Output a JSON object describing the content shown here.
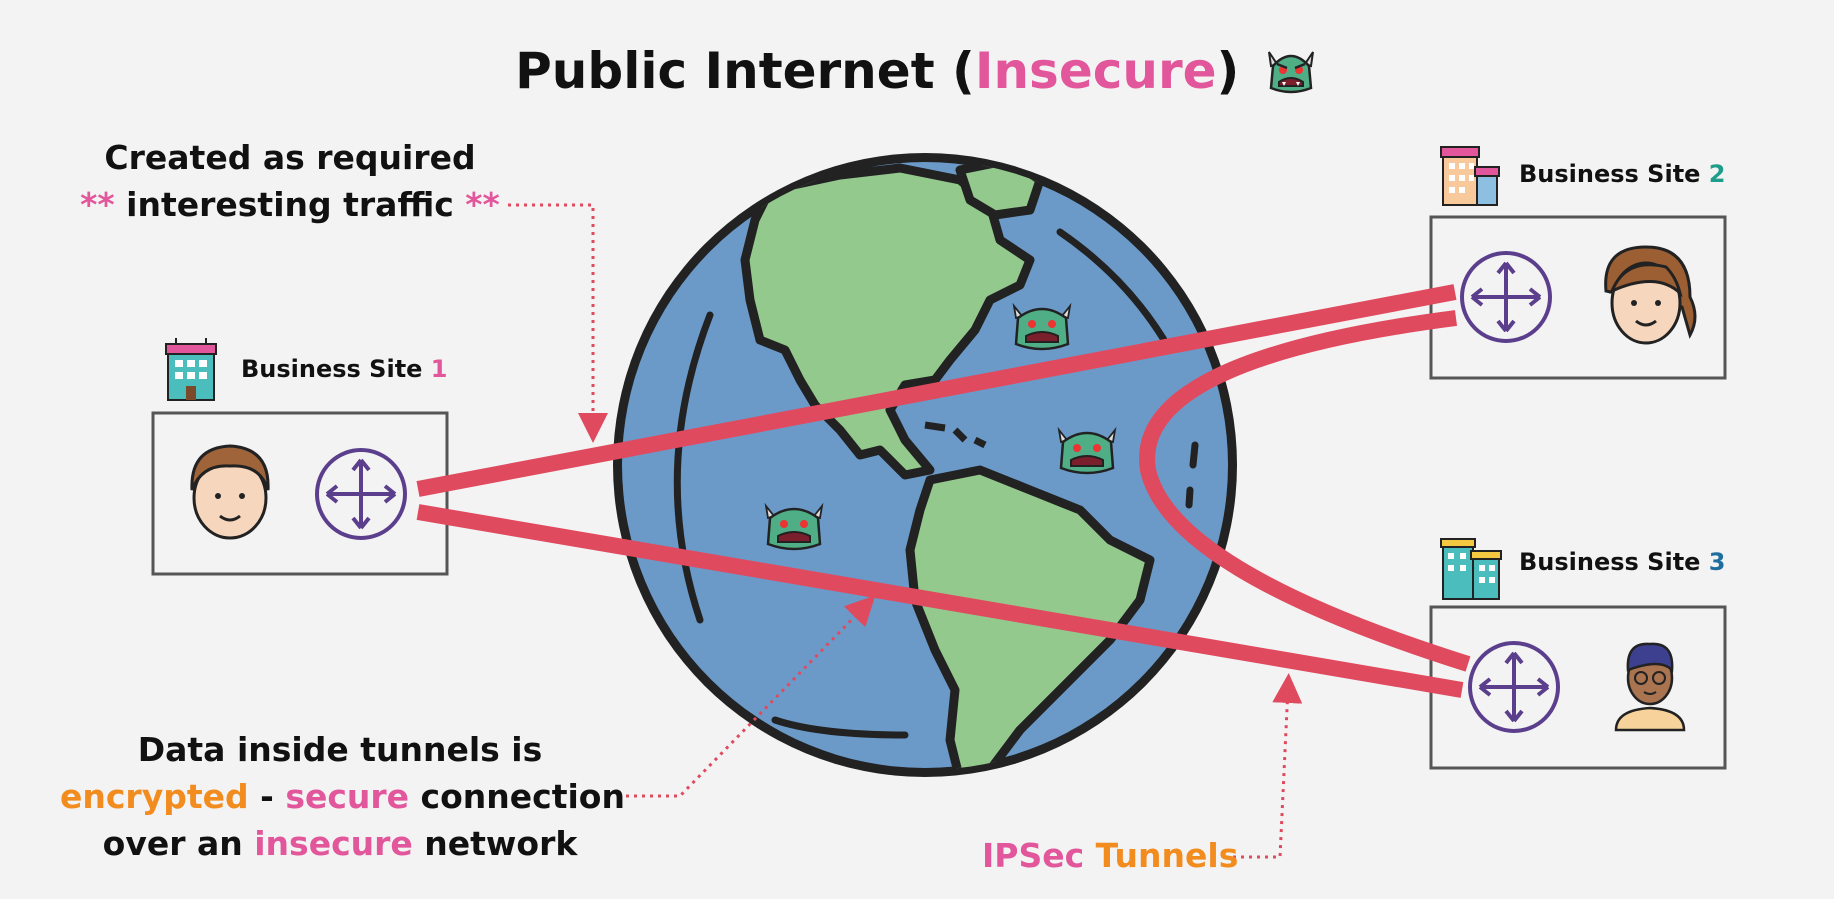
{
  "title": {
    "main": "Public Internet (",
    "highlight": "Insecure",
    "close": ")",
    "icon": "monster-icon"
  },
  "note_top": {
    "line1": "Created as required",
    "stars_left": "**",
    "line2": " interesting traffic ",
    "stars_right": "**"
  },
  "note_bottom": {
    "line1": "Data inside tunnels is",
    "encrypted": "encrypted",
    "dash": " - ",
    "secure": "secure",
    "connection": " connection",
    "over_an": "over an ",
    "insecure": "insecure",
    "network": " network"
  },
  "tunnels_label": {
    "ipsec": "IPSec",
    "tunnels": " Tunnels"
  },
  "sites": [
    {
      "label": "Business Site ",
      "number": "1",
      "icon": "building-icon",
      "person": "person-icon",
      "router": "router-icon"
    },
    {
      "label": "Business Site ",
      "number": "2",
      "icon": "building-icon",
      "person": "person-icon",
      "router": "router-icon"
    },
    {
      "label": "Business Site ",
      "number": "3",
      "icon": "building-icon",
      "person": "person-icon",
      "router": "router-icon"
    }
  ],
  "colors": {
    "background": "#f3f3f3",
    "ocean": "#6b9ac9",
    "land": "#94c98e",
    "outline": "#222222",
    "tunnel": "#e04a5f",
    "router": "#5b3f8c",
    "pink": "#e2569b",
    "orange": "#f28c1e",
    "monster": "#4fae86"
  }
}
